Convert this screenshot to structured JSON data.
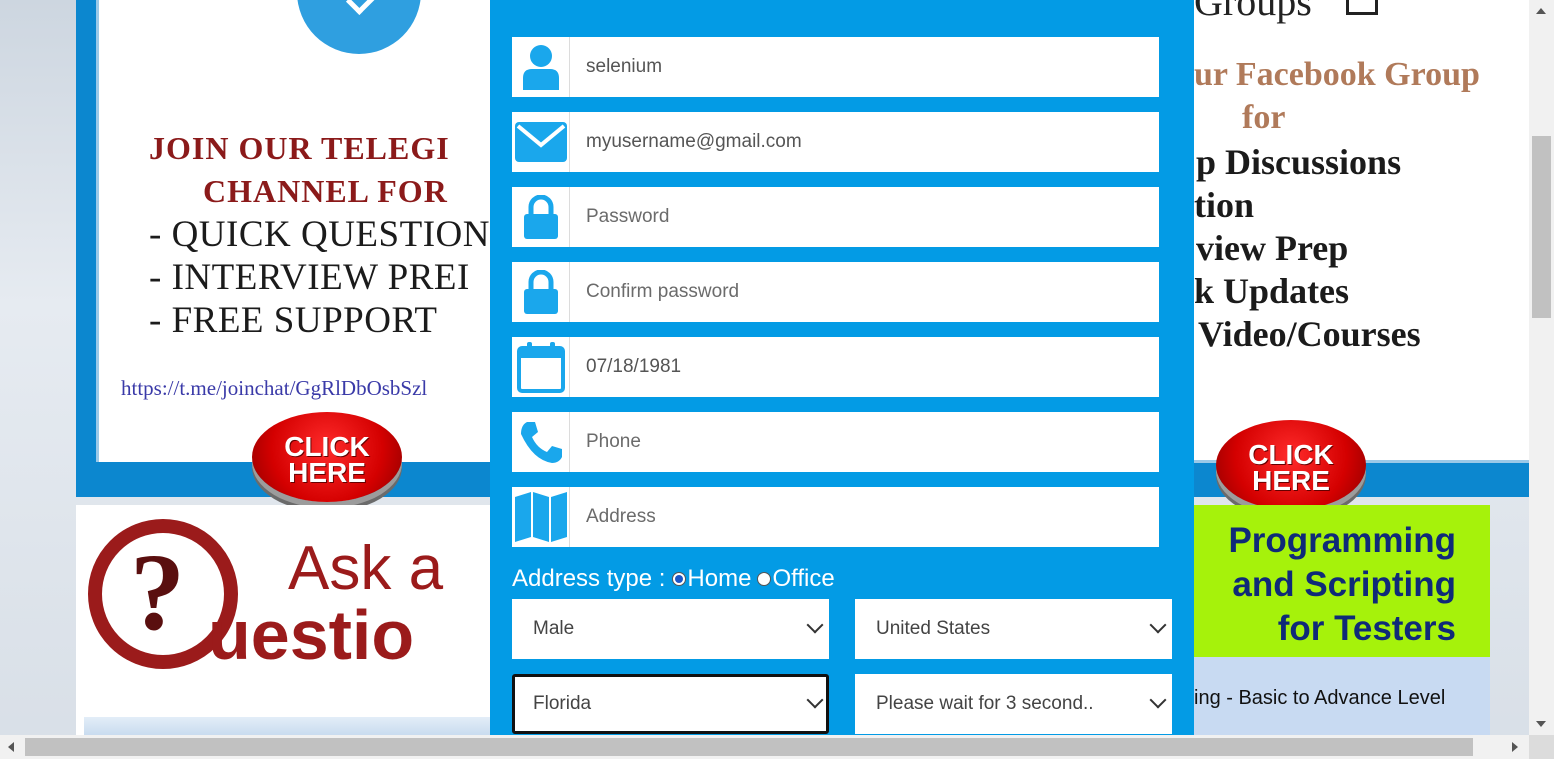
{
  "left_banner": {
    "title_line1": "JOIN OUR TELEGI",
    "title_line2": "CHANNEL  FOR",
    "items": [
      "- QUICK QUESTION",
      "- INTERVIEW PREI",
      "- FREE SUPPORT"
    ],
    "url": "https://t.me/joinchat/GgRlDbOsbSzl",
    "click_label_1": "CLICK",
    "click_label_2": "HERE"
  },
  "right_banner": {
    "groups_text": "Groups",
    "title_line1": "ur Facebook Group",
    "title_line2": "for",
    "items": [
      "p Discussions",
      "tion",
      "view Prep",
      "k Updates",
      "Video/Courses"
    ],
    "click_label_1": "CLICK",
    "click_label_2": "HERE"
  },
  "ask_banner": {
    "line1": "Ask a",
    "line2": "uestio",
    "q_mark": "?"
  },
  "programming_banner": {
    "line1": "Programming",
    "line2": "and Scripting",
    "line3": "for Testers",
    "subtext": "ing - Basic to Advance Level"
  },
  "form": {
    "username_value": "selenium",
    "email_value": "myusername@gmail.com",
    "password_placeholder": "Password",
    "confirm_password_placeholder": "Confirm password",
    "dob_value": "07/18/1981",
    "phone_placeholder": "Phone",
    "address_placeholder": "Address",
    "address_type_label": "Address type :",
    "address_type_options": [
      "Home",
      "Office"
    ],
    "address_type_selected": "Home",
    "gender_selected": "Male",
    "country_selected": "United States",
    "state_selected": "Florida",
    "city_selected": "Please wait for 3 second.."
  },
  "colors": {
    "form_bg": "#039be5",
    "icon_color": "#1aa7ec",
    "banner_blue": "#0c87cf"
  }
}
